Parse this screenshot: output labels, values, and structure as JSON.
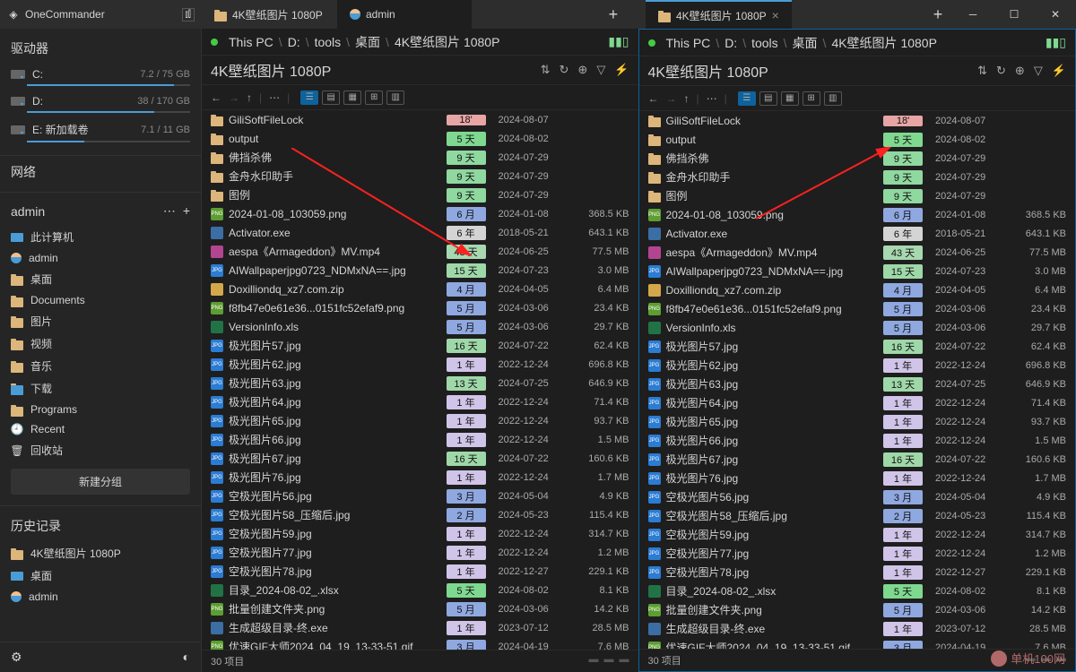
{
  "app": {
    "name": "OneCommander"
  },
  "titlebar": {
    "tabsLeft": [
      {
        "label": "4K壁纸图片 1080P",
        "icon": "folder",
        "active": false
      },
      {
        "label": "admin",
        "icon": "user",
        "active": true
      }
    ],
    "tabsRight": [
      {
        "label": "4K壁纸图片 1080P",
        "icon": "folder",
        "active": true,
        "closable": true
      }
    ]
  },
  "sidebar": {
    "drives_header": "驱动器",
    "drives": [
      {
        "label": "C:",
        "size": "7.2 / 75 GB",
        "pct": 90
      },
      {
        "label": "D:",
        "size": "38 / 170 GB",
        "pct": 78
      },
      {
        "label": "E:  新加载卷",
        "size": "7.1 / 11 GB",
        "pct": 35
      }
    ],
    "network_header": "网络",
    "admin_header": "admin",
    "favorites": [
      {
        "label": "此计算机",
        "ic": "pc"
      },
      {
        "label": "admin",
        "ic": "user"
      },
      {
        "label": "桌面",
        "ic": "folder"
      },
      {
        "label": "Documents",
        "ic": "folder"
      },
      {
        "label": "图片",
        "ic": "folder"
      },
      {
        "label": "视频",
        "ic": "folder"
      },
      {
        "label": "音乐",
        "ic": "folder"
      },
      {
        "label": "下载",
        "ic": "folder-blue"
      },
      {
        "label": "Programs",
        "ic": "folder"
      },
      {
        "label": "Recent",
        "ic": "recent"
      },
      {
        "label": "回收站",
        "ic": "trash"
      }
    ],
    "new_group": "新建分组",
    "history_header": "历史记录",
    "history": [
      {
        "label": "4K壁纸图片 1080P",
        "ic": "folder"
      },
      {
        "label": "桌面",
        "ic": "pc"
      },
      {
        "label": "admin",
        "ic": "user"
      }
    ]
  },
  "pane": {
    "path": [
      "This PC",
      "D:",
      "tools",
      "桌面",
      "4K壁纸图片 1080P"
    ],
    "title": "4K壁纸图片 1080P",
    "status": "30 项目",
    "files": [
      {
        "ic": "folder",
        "name": "GiliSoftFileLock",
        "age": "18'",
        "ageColor": "#e8a5a5",
        "date": "2024-08-07",
        "size": ""
      },
      {
        "ic": "folder",
        "name": "output",
        "age": "5 天",
        "ageColor": "#7fd88f",
        "date": "2024-08-02",
        "size": ""
      },
      {
        "ic": "folder",
        "name": "佛挡杀佛",
        "age": "9 天",
        "ageColor": "#8fd89f",
        "date": "2024-07-29",
        "size": ""
      },
      {
        "ic": "folder",
        "name": "金舟水印助手",
        "age": "9 天",
        "ageColor": "#8fd89f",
        "date": "2024-07-29",
        "size": ""
      },
      {
        "ic": "folder",
        "name": "图例",
        "age": "9 天",
        "ageColor": "#8fd89f",
        "date": "2024-07-29",
        "size": ""
      },
      {
        "ic": "png",
        "name": "2024-01-08_103059.png",
        "age": "6 月",
        "ageColor": "#8fa8e0",
        "date": "2024-01-08",
        "size": "368.5 KB"
      },
      {
        "ic": "exe",
        "name": "Activator.exe",
        "age": "6 年",
        "ageColor": "#d4d4d4",
        "date": "2018-05-21",
        "size": "643.1 KB"
      },
      {
        "ic": "mp4",
        "name": "aespa《Armageddon》MV.mp4",
        "age": "43 天",
        "ageColor": "#a8d8b0",
        "date": "2024-06-25",
        "size": "77.5 MB"
      },
      {
        "ic": "jpg",
        "name": "AIWallpaperjpg0723_NDMxNA==.jpg",
        "age": "15 天",
        "ageColor": "#9fd8a8",
        "date": "2024-07-23",
        "size": "3.0 MB"
      },
      {
        "ic": "zip",
        "name": "Doxilliondq_xz7.com.zip",
        "age": "4 月",
        "ageColor": "#8fa8e0",
        "date": "2024-04-05",
        "size": "6.4 MB"
      },
      {
        "ic": "png",
        "name": "f8fb47e0e61e36...0151fc52efaf9.png",
        "age": "5 月",
        "ageColor": "#8fa8e0",
        "date": "2024-03-06",
        "size": "23.4 KB"
      },
      {
        "ic": "xls",
        "name": "VersionInfo.xls",
        "age": "5 月",
        "ageColor": "#8fa8e0",
        "date": "2024-03-06",
        "size": "29.7 KB"
      },
      {
        "ic": "jpg",
        "name": "极光图片57.jpg",
        "age": "16 天",
        "ageColor": "#9fd8a8",
        "date": "2024-07-22",
        "size": "62.4 KB"
      },
      {
        "ic": "jpg",
        "name": "极光图片62.jpg",
        "age": "1 年",
        "ageColor": "#d0c4e8",
        "date": "2022-12-24",
        "size": "696.8 KB"
      },
      {
        "ic": "jpg",
        "name": "极光图片63.jpg",
        "age": "13 天",
        "ageColor": "#9fd8a8",
        "date": "2024-07-25",
        "size": "646.9 KB"
      },
      {
        "ic": "jpg",
        "name": "极光图片64.jpg",
        "age": "1 年",
        "ageColor": "#d0c4e8",
        "date": "2022-12-24",
        "size": "71.4 KB"
      },
      {
        "ic": "jpg",
        "name": "极光图片65.jpg",
        "age": "1 年",
        "ageColor": "#d0c4e8",
        "date": "2022-12-24",
        "size": "93.7 KB"
      },
      {
        "ic": "jpg",
        "name": "极光图片66.jpg",
        "age": "1 年",
        "ageColor": "#d0c4e8",
        "date": "2022-12-24",
        "size": "1.5 MB"
      },
      {
        "ic": "jpg",
        "name": "极光图片67.jpg",
        "age": "16 天",
        "ageColor": "#9fd8a8",
        "date": "2024-07-22",
        "size": "160.6 KB"
      },
      {
        "ic": "jpg",
        "name": "极光图片76.jpg",
        "age": "1 年",
        "ageColor": "#d0c4e8",
        "date": "2022-12-24",
        "size": "1.7 MB"
      },
      {
        "ic": "jpg",
        "name": "空极光图片56.jpg",
        "age": "3 月",
        "ageColor": "#8fa8e0",
        "date": "2024-05-04",
        "size": "4.9 KB"
      },
      {
        "ic": "jpg",
        "name": "空极光图片58_压缩后.jpg",
        "age": "2 月",
        "ageColor": "#8fa8e0",
        "date": "2024-05-23",
        "size": "115.4 KB"
      },
      {
        "ic": "jpg",
        "name": "空极光图片59.jpg",
        "age": "1 年",
        "ageColor": "#d0c4e8",
        "date": "2022-12-24",
        "size": "314.7 KB"
      },
      {
        "ic": "jpg",
        "name": "空极光图片77.jpg",
        "age": "1 年",
        "ageColor": "#d0c4e8",
        "date": "2022-12-24",
        "size": "1.2 MB"
      },
      {
        "ic": "jpg",
        "name": "空极光图片78.jpg",
        "age": "1 年",
        "ageColor": "#d0c4e8",
        "date": "2022-12-27",
        "size": "229.1 KB"
      },
      {
        "ic": "xls",
        "name": "目录_2024-08-02_.xlsx",
        "age": "5 天",
        "ageColor": "#7fd88f",
        "date": "2024-08-02",
        "size": "8.1 KB"
      },
      {
        "ic": "png",
        "name": "批量创建文件夹.png",
        "age": "5 月",
        "ageColor": "#8fa8e0",
        "date": "2024-03-06",
        "size": "14.2 KB"
      },
      {
        "ic": "exe",
        "name": "生成超级目录-终.exe",
        "age": "1 年",
        "ageColor": "#d0c4e8",
        "date": "2023-07-12",
        "size": "28.5 MB"
      },
      {
        "ic": "png",
        "name": "优速GIF大师2024_04_19_13-33-51.gif",
        "age": "3 月",
        "ageColor": "#8fa8e0",
        "date": "2024-04-19",
        "size": "7.6 MB"
      }
    ]
  },
  "watermark": "单机100网"
}
